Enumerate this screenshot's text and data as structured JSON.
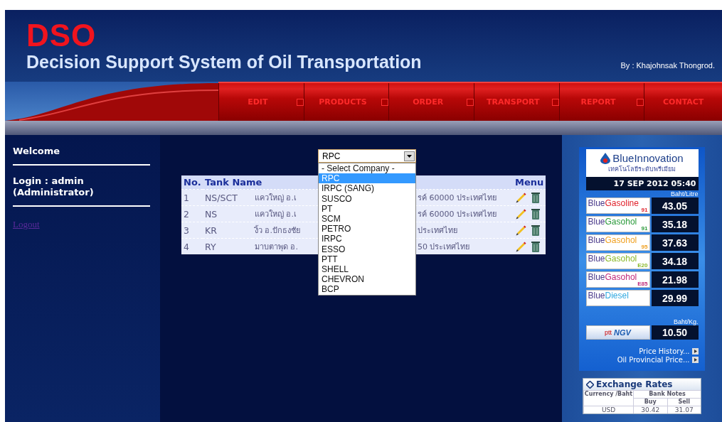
{
  "header": {
    "logo": "DSO",
    "title": "Decision Support System of Oil Transportation",
    "author": "By : Khajohnsak Thongrod."
  },
  "menu": [
    {
      "label": "EDIT"
    },
    {
      "label": "PRODUCTS"
    },
    {
      "label": "ORDER"
    },
    {
      "label": "TRANSPORT"
    },
    {
      "label": "REPORT"
    },
    {
      "label": "CONTACT"
    }
  ],
  "sidebar": {
    "welcome": "Welcome",
    "login": "Login : admin (Administrator)",
    "logout": "Logout"
  },
  "company_select": {
    "value": "RPC",
    "options": [
      {
        "label": "- Select Company -",
        "selected": false
      },
      {
        "label": "RPC",
        "selected": true
      },
      {
        "label": "IRPC (SANG)",
        "selected": false
      },
      {
        "label": "SUSCO",
        "selected": false
      },
      {
        "label": "PT",
        "selected": false
      },
      {
        "label": "SCM",
        "selected": false
      },
      {
        "label": "PETRO",
        "selected": false
      },
      {
        "label": "IRPC",
        "selected": false
      },
      {
        "label": "ESSO",
        "selected": false
      },
      {
        "label": "PTT",
        "selected": false
      },
      {
        "label": "SHELL",
        "selected": false
      },
      {
        "label": "CHEVRON",
        "selected": false
      },
      {
        "label": "BCP",
        "selected": false
      }
    ]
  },
  "table": {
    "columns": [
      "No.",
      "Tank Name",
      "Menu"
    ],
    "rows": [
      {
        "no": "1",
        "tank": "NS/SCT",
        "address_start": "แควใหญ่ อ.เ",
        "address_end": "รค์ 60000 ประเทศไทย"
      },
      {
        "no": "2",
        "tank": "NS",
        "address_start": "แควใหญ่ อ.เ",
        "address_end": "รค์ 60000 ประเทศไทย"
      },
      {
        "no": "3",
        "tank": "KR",
        "address_start": "งิ้ว อ.ปักธงชัย",
        "address_end": "ประเทศไทย"
      },
      {
        "no": "4",
        "tank": "RY",
        "address_start": "มาบตาพุด อ.",
        "address_end": "50 ประเทศไทย"
      }
    ]
  },
  "price_board": {
    "brand_prefix": "Blue",
    "brand": "Innovation",
    "tagline": "เทคโนโลยีระดับพรีเมียม",
    "date": "17 SEP 2012 05:40",
    "unit_litre": "Baht/Litre",
    "fuels": [
      {
        "prefix": "Blue",
        "name": "Gasoline",
        "grade": "91",
        "color": "#e0202a",
        "price": "43.05"
      },
      {
        "prefix": "Blue",
        "name": "Gasohol",
        "grade": "91",
        "color": "#2a9a3a",
        "price": "35.18"
      },
      {
        "prefix": "Blue",
        "name": "Gasohol",
        "grade": "95",
        "color": "#f0a020",
        "price": "37.63"
      },
      {
        "prefix": "Blue",
        "name": "Gasohol",
        "grade": "E20",
        "color": "#8ab828",
        "price": "34.18"
      },
      {
        "prefix": "Blue",
        "name": "Gasohol",
        "grade": "E85",
        "color": "#c0287a",
        "price": "21.98"
      },
      {
        "prefix": "Blue",
        "name": "Diesel",
        "color": "#30a8e0",
        "price": "29.99"
      }
    ],
    "unit_kg": "Baht/Kg.",
    "ngv": {
      "company": "ptt",
      "name": "NGV",
      "price": "10.50"
    },
    "links": [
      "Price History...",
      "Oil Provincial Price..."
    ]
  },
  "exchange": {
    "title": "Exchange Rates",
    "currency_header": "Currency /Baht",
    "notes_header": "Bank Notes",
    "buy": "Buy",
    "sell": "Sell",
    "rows": [
      {
        "currency": "USD",
        "buy": "30.42",
        "sell": "31.07"
      }
    ]
  }
}
